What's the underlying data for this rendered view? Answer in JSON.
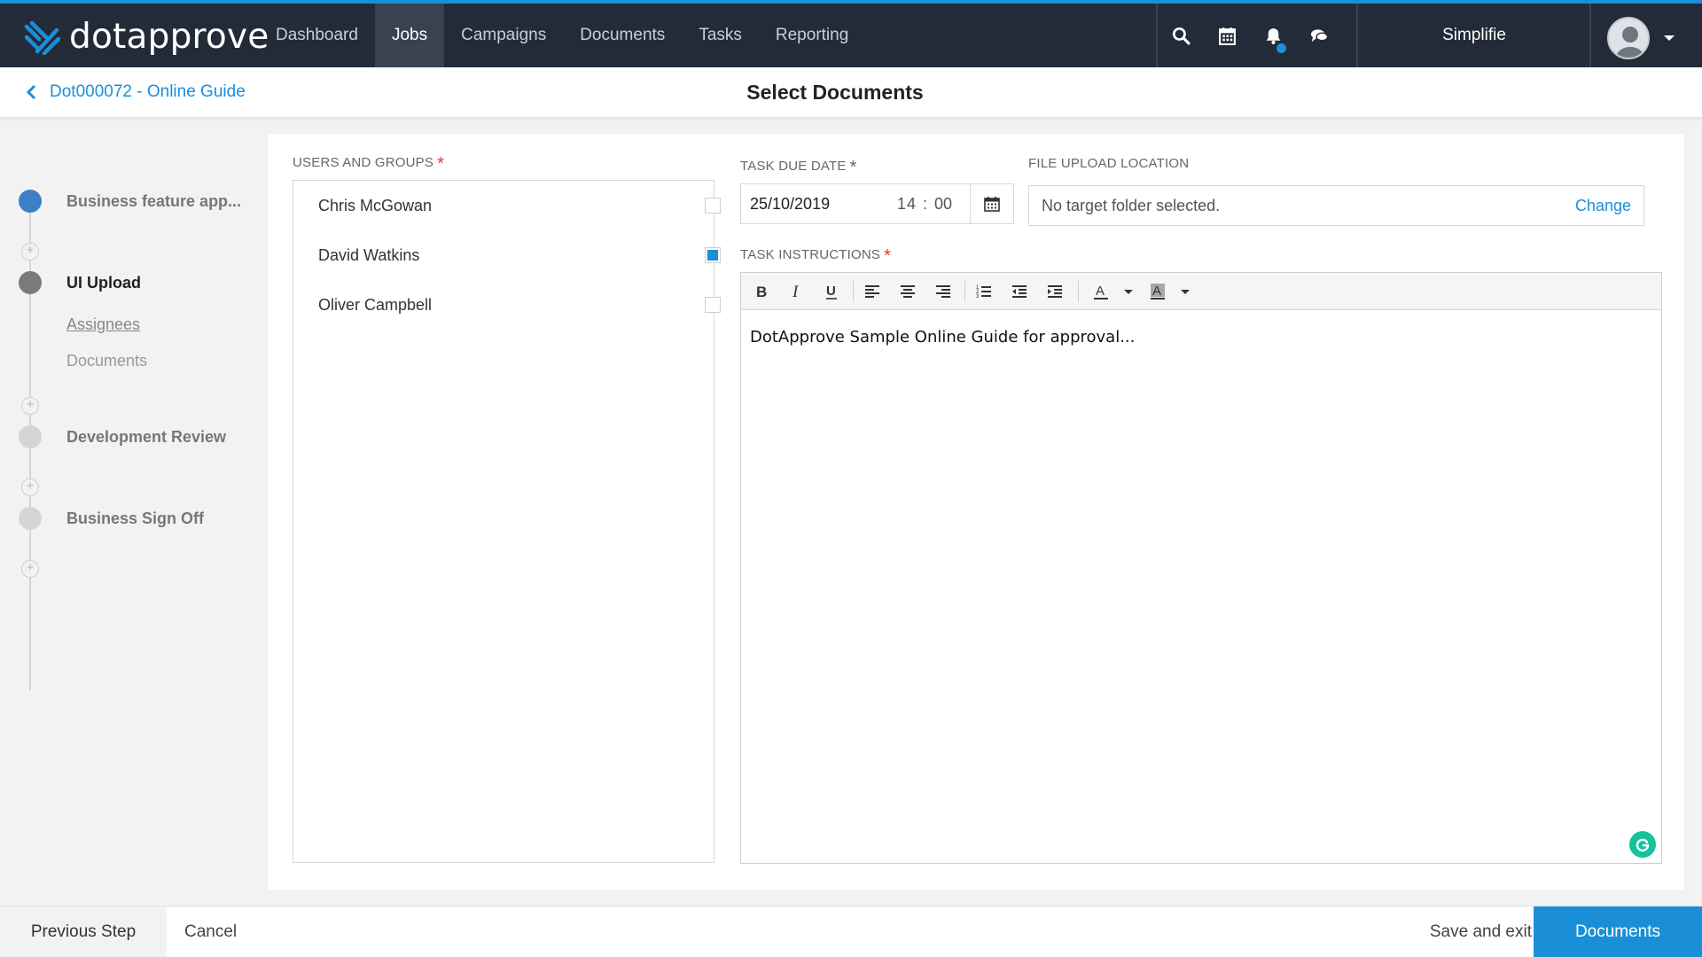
{
  "app": {
    "brand": "dotapprove",
    "org_name": "Simplifie",
    "accent_color": "#1a8fd8",
    "nav_bg_color": "#232b38"
  },
  "nav": {
    "links": [
      {
        "label": "Dashboard",
        "active": false
      },
      {
        "label": "Jobs",
        "active": true
      },
      {
        "label": "Campaigns",
        "active": false
      },
      {
        "label": "Documents",
        "active": false
      },
      {
        "label": "Tasks",
        "active": false
      },
      {
        "label": "Reporting",
        "active": false
      }
    ],
    "icons": [
      "search-icon",
      "calendar-icon",
      "bell-icon",
      "chat-icon"
    ]
  },
  "subheader": {
    "back_label": "Dot000072 - Online Guide",
    "title": "Select Documents"
  },
  "steps": {
    "items": [
      {
        "label": "Business feature app...",
        "state": "done",
        "color": "#3d7ec9"
      },
      {
        "label": "UI Upload",
        "state": "current",
        "color": "#7a7a7a"
      },
      {
        "label": "Development Review",
        "state": "pending",
        "color": "#d5d5d5"
      },
      {
        "label": "Business Sign Off",
        "state": "pending",
        "color": "#d5d5d5"
      }
    ],
    "sub_steps": [
      {
        "label": "Assignees",
        "link": true
      },
      {
        "label": "Documents",
        "link": false
      }
    ]
  },
  "form": {
    "users_label": "USERS AND GROUPS",
    "users": [
      {
        "name": "Chris McGowan",
        "checked": false
      },
      {
        "name": "David Watkins",
        "checked": true
      },
      {
        "name": "Oliver Campbell",
        "checked": false
      }
    ],
    "due_date_label": "TASK DUE DATE",
    "due_date": "25/10/2019",
    "due_hour": "14",
    "due_minute": "00",
    "upload_label": "FILE UPLOAD LOCATION",
    "upload_value": "No target folder selected.",
    "upload_change": "Change",
    "instructions_label": "TASK INSTRUCTIONS",
    "instructions_text": "DotApprove Sample Online Guide for approval...",
    "required_mark": "*",
    "toolbar_icons": [
      "bold-icon",
      "italic-icon",
      "underline-icon",
      "align-left-icon",
      "align-center-icon",
      "align-right-icon",
      "ordered-list-icon",
      "outdent-icon",
      "indent-icon",
      "font-color-icon",
      "highlight-color-icon"
    ]
  },
  "footer": {
    "previous_label": "Previous Step",
    "cancel_label": "Cancel",
    "save_exit_label": "Save and exit",
    "next_label": "Documents"
  }
}
